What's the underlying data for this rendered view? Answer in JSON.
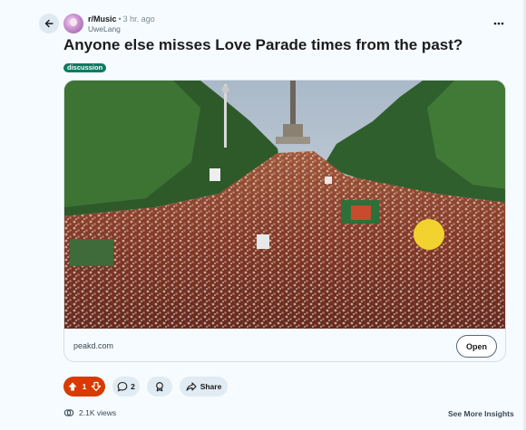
{
  "post": {
    "subreddit": "r/Music",
    "separator": "•",
    "time": "3 hr. ago",
    "author": "UweLang",
    "title": "Anyone else misses Love Parade times from the past?",
    "flair": "discussion",
    "flair_color": "#0d7a61"
  },
  "link_card": {
    "domain": "peakd.com",
    "open_label": "Open"
  },
  "actions": {
    "vote_count": "1",
    "comment_count": "2",
    "share_label": "Share",
    "vote_color": "#d93a00"
  },
  "footer": {
    "views": "2.1K views",
    "insights_label": "See More Insights"
  },
  "icons": [
    "back-arrow-icon",
    "subreddit-avatar",
    "more-options-icon",
    "upvote-icon",
    "downvote-icon",
    "comment-icon",
    "award-icon",
    "share-icon",
    "views-icon"
  ]
}
